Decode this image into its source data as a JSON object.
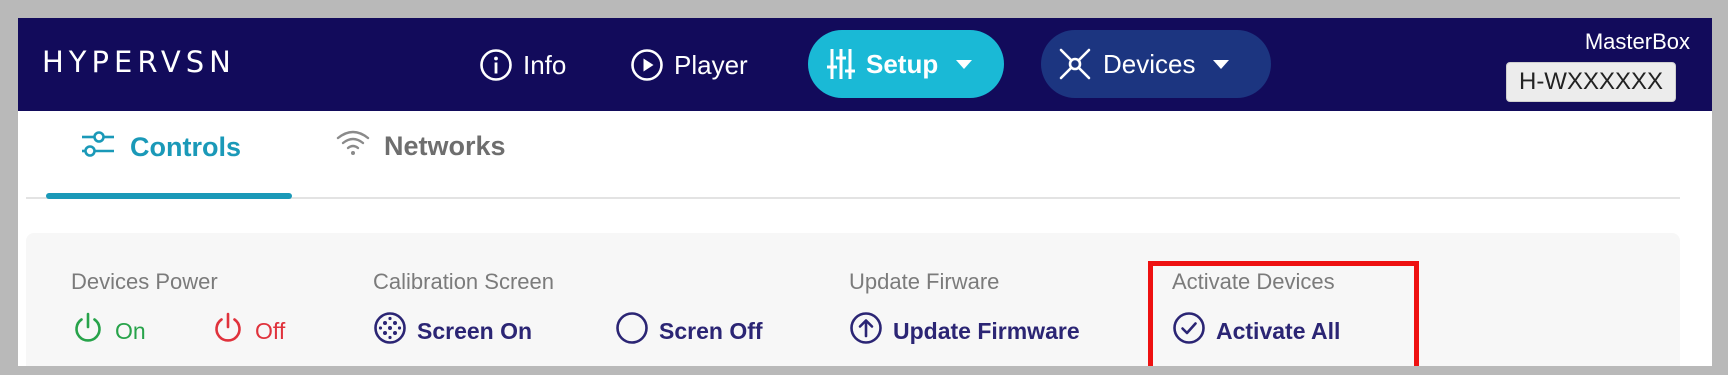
{
  "header": {
    "logo": "HYPERVSN",
    "nav": {
      "info": "Info",
      "player": "Player",
      "setup": "Setup",
      "devices": "Devices"
    },
    "masterbox_label": "MasterBox",
    "masterbox_id": "H-WXXXXXX"
  },
  "tabs": [
    {
      "label": "Controls",
      "active": true,
      "icon": "sliders-icon"
    },
    {
      "label": "Networks",
      "active": false,
      "icon": "wifi-icon"
    }
  ],
  "panel": {
    "devices_power": {
      "title": "Devices Power",
      "on_label": "On",
      "off_label": "Off"
    },
    "calibration": {
      "title": "Calibration Screen",
      "on_label": "Screen On",
      "off_label": "Scren Off"
    },
    "update": {
      "title": "Update Firware",
      "button_label": "Update Firmware"
    },
    "activate": {
      "title": "Activate Devices",
      "button_label": "Activate All"
    }
  },
  "colors": {
    "header_bg": "#120b5b",
    "setup_active": "#1ab9d6",
    "devices_pill": "#1c3580",
    "tab_active": "#1a99b8",
    "power_on": "#27a34a",
    "power_off": "#e0323c",
    "action_text": "#2b2574",
    "highlight": "#ee1111"
  }
}
